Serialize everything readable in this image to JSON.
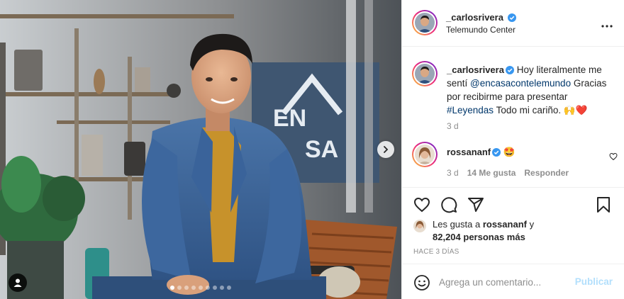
{
  "post": {
    "author": {
      "username": "_carlosrivera",
      "verified": true,
      "location": "Telemundo Center"
    },
    "caption": {
      "text_before": "Hoy literalmente me sentí ",
      "mention": "@encasacontelemundo",
      "text_middle": " Gracias por recibirme para presentar ",
      "hashtag": "#Leyendas",
      "text_after": " Todo mi cariño. 🙌❤️",
      "time": "3 d"
    },
    "comments": [
      {
        "username": "rossananf",
        "verified": true,
        "text": "🤩",
        "time": "3 d",
        "likes": "14 Me gusta",
        "reply_label": "Responder"
      }
    ],
    "likes": {
      "prefix": "Les gusta a ",
      "first_user": "rossananf",
      "middle": " y",
      "count": "82,204 personas más"
    },
    "posted_ago": "HACE 3 DÍAS",
    "comment_box": {
      "placeholder": "Agrega un comentario...",
      "publish_label": "Publicar"
    },
    "carousel": {
      "total": 9,
      "active_index": 0
    },
    "media": {
      "sign_text_1": "EN",
      "sign_text_2": "SA"
    }
  },
  "icons": {
    "more": "more-options-icon",
    "like": "heart-icon",
    "comment": "comment-icon",
    "share": "paper-plane-icon",
    "save": "bookmark-icon",
    "emoji": "smiley-icon",
    "next": "chevron-right-icon",
    "tags": "user-tag-icon"
  },
  "colors": {
    "verified_blue": "#3897f0",
    "link_blue": "#00376b",
    "muted": "#8e8e8e",
    "publish_disabled": "#b2dffc"
  }
}
